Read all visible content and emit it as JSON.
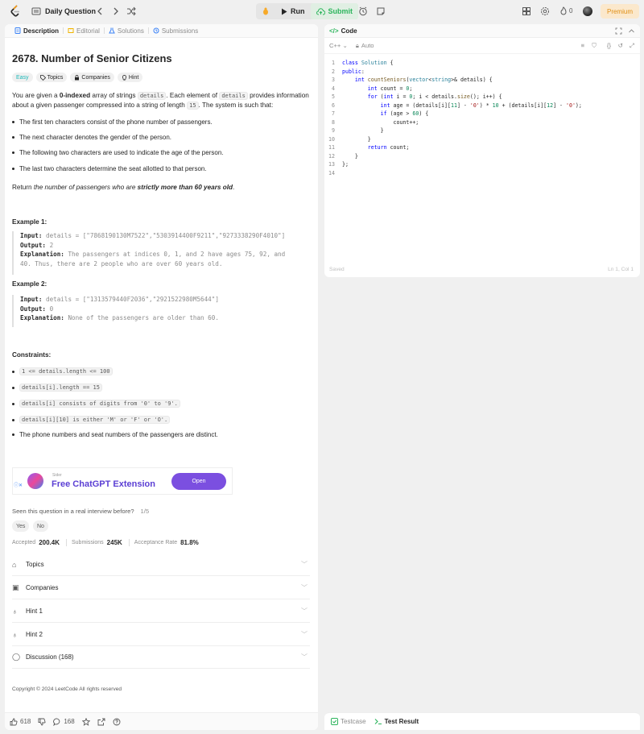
{
  "topbar": {
    "daily_question": "Daily Question",
    "run": "Run",
    "submit": "Submit",
    "streak": "0",
    "premium": "Premium"
  },
  "tabs": [
    "Description",
    "Editorial",
    "Solutions",
    "Submissions"
  ],
  "problem": {
    "title": "2678. Number of Senior Citizens",
    "difficulty": "Easy",
    "chips": [
      "Topics",
      "Companies",
      "Hint"
    ],
    "desc_1a": "You are given a ",
    "desc_1b": "0-indexed",
    "desc_1c": " array of strings ",
    "desc_code1": "details",
    "desc_1d": ". Each element of ",
    "desc_code2": "details",
    "desc_1e": " provides information about a given passenger compressed into a string of length ",
    "desc_code3": "15",
    "desc_1f": ". The system is such that:",
    "bullets": [
      "The first ten characters consist of the phone number of passengers.",
      "The next character denotes the gender of the person.",
      "The following two characters are used to indicate the age of the person.",
      "The last two characters determine the seat allotted to that person."
    ],
    "return_a": "Return ",
    "return_b": "the number of passengers who are ",
    "return_c": "strictly more than 60 years old",
    "return_d": "."
  },
  "examples": [
    {
      "heading": "Example 1:",
      "input_label": "Input:",
      "input": " details = [\"7868190130M7522\",\"5303914400F9211\",\"9273338290F4010\"]",
      "output_label": "Output:",
      "output": " 2",
      "expl_label": "Explanation:",
      "expl": " The passengers at indices 0, 1, and 2 have ages 75, 92, and",
      "expl2": "40. Thus, there are 2 people who are over 60 years old."
    },
    {
      "heading": "Example 2:",
      "input_label": "Input:",
      "input": " details = [\"1313579440F2036\",\"2921522980M5644\"]",
      "output_label": "Output:",
      "output": " 0",
      "expl_label": "Explanation:",
      "expl": " None of the passengers are older than 60."
    }
  ],
  "constraints": {
    "heading": "Constraints:",
    "items": [
      "1 <= details.length <= 100",
      "details[i].length == 15",
      "details[i] consists of digits from '0' to '9'.",
      "details[i][10] is either 'M' or 'F' or 'O'.",
      "The phone numbers and seat numbers of the passengers are distinct."
    ]
  },
  "ad": {
    "brand": "Sider",
    "title": "Free ChatGPT Extension",
    "button": "Open"
  },
  "seen": {
    "question": "Seen this question in a real interview before?",
    "fraction": "1/5",
    "yes": "Yes",
    "no": "No"
  },
  "stats": {
    "accepted_label": "Accepted",
    "accepted": "200.4K",
    "submissions_label": "Submissions",
    "submissions": "245K",
    "rate_label": "Acceptance Rate",
    "rate": "81.8%"
  },
  "accordions": [
    "Topics",
    "Companies",
    "Hint 1",
    "Hint 2",
    "Discussion (168)"
  ],
  "copyright": "Copyright © 2024 LeetCode All rights reserved",
  "bottom": {
    "likes": "618",
    "comments": "168"
  },
  "code": {
    "header": "Code",
    "language": "C++",
    "auto": "Auto",
    "saved": "Saved",
    "cursor": "Ln 1, Col 1",
    "line_numbers": [
      "1",
      "2",
      "3",
      "4",
      "5",
      "6",
      "7",
      "8",
      "9",
      "10",
      "11",
      "12",
      "13",
      "14"
    ]
  },
  "bottom_right": {
    "testcase": "Testcase",
    "result": "Test Result"
  },
  "colors": {
    "accent_green": "#2db55d",
    "easy": "#1cb8b8",
    "premium": "#e08f14"
  }
}
